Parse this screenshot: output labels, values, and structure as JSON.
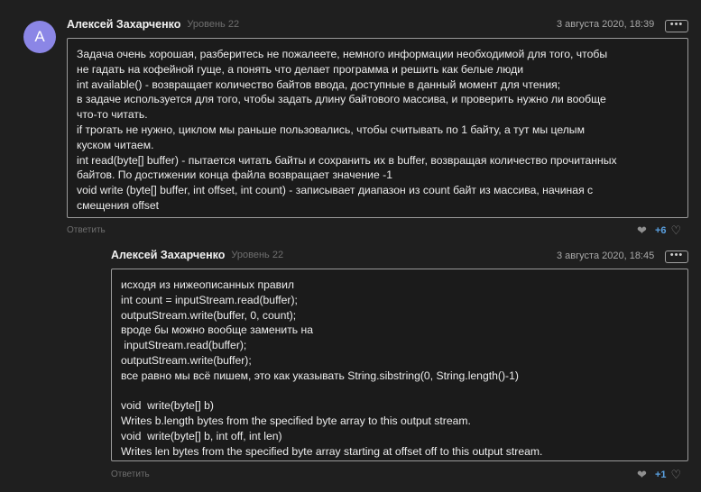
{
  "comments": [
    {
      "avatar_letter": "A",
      "author": "Алексей Захарченко",
      "level": "Уровень 22",
      "date": "3 августа 2020, 18:39",
      "more": "•••",
      "lines": [
        "Задача очень хорошая, разберитесь не пожалеете, немного информации необходимой для того, чтобы",
        "не гадать на кофейной гуще, а понять что делает программа и решить как белые люди",
        "int available() - возвращает количество байтов ввода, доступные в данный момент для чтения;",
        "в задаче используется для того, чтобы задать длину байтового массива, и проверить нужно ли вообще",
        "что-то читать.",
        "if трогать не нужно, циклом мы раньше пользовались, чтобы считывать по 1 байту, а тут мы целым",
        "куском читаем.",
        "int read(byte[] buffer) - пытается читать байты и сохранить их в buffer, возвращая количество прочитанных",
        "байтов. По достижении конца файла возвращает значение -1",
        "void write (byte[] buffer, int offset, int count) - записывает диапазон из count байт из массива, начиная с",
        "смещения offset"
      ],
      "reply_label": "Ответить",
      "likes": "+6"
    },
    {
      "author": "Алексей Захарченко",
      "level": "Уровень 22",
      "date": "3 августа 2020, 18:45",
      "more": "•••",
      "lines": [
        "исходя из нижеописанных правил",
        "int count = inputStream.read(buffer);",
        "outputStream.write(buffer, 0, count);",
        "вроде бы можно вообще заменить на",
        " inputStream.read(buffer);",
        "outputStream.write(buffer);",
        "все равно мы всё пишем, это как указывать String.sibstring(0, String.length()-1)",
        "",
        "void  write(byte[] b)",
        "Writes b.length bytes from the specified byte array to this output stream.",
        "void  write(byte[] b, int off, int len)",
        "Writes len bytes from the specified byte array starting at offset off to this output stream."
      ],
      "reply_label": "Ответить",
      "likes": "+1"
    }
  ]
}
